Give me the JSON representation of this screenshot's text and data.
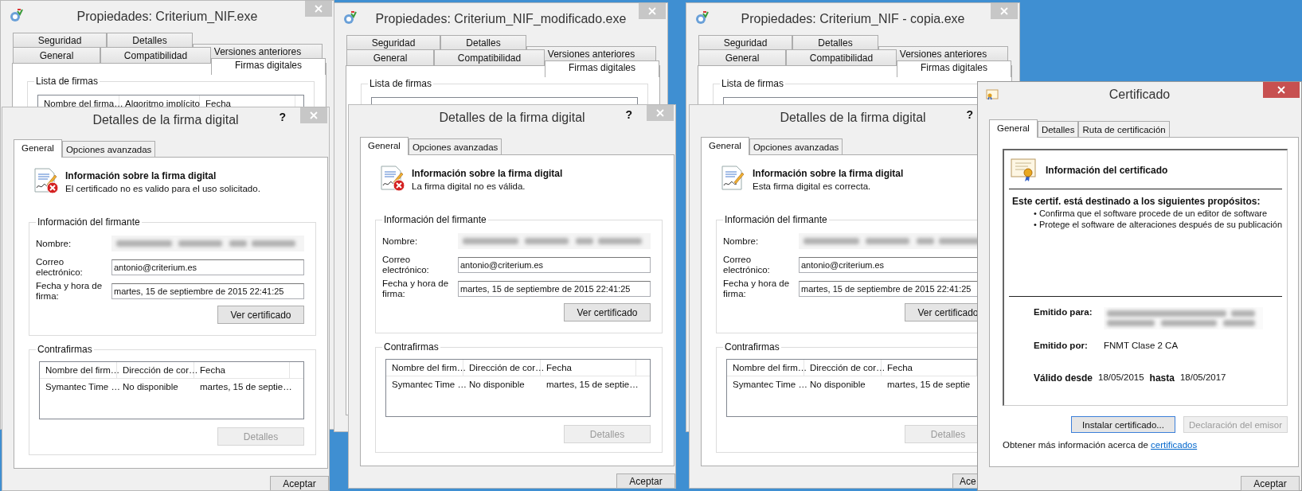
{
  "groups": [
    {
      "properties": {
        "title": "Propiedades: Criterium_NIF.exe",
        "active": false,
        "tab_rows": [
          [
            {
              "label": "Seguridad",
              "selected": false
            },
            {
              "label": "Detalles",
              "selected": false
            },
            {
              "label": "Versiones anteriores",
              "selected": false
            }
          ],
          [
            {
              "label": "General",
              "selected": false
            },
            {
              "label": "Compatibilidad",
              "selected": false
            },
            {
              "label": "Firmas digitales",
              "selected": true
            }
          ]
        ],
        "group_label": "Lista de firmas",
        "columns": [
          "Nombre del firma…",
          "Algoritmo implícito",
          "Fecha"
        ]
      },
      "details": {
        "title": "Detalles de la firma digital",
        "help": "?",
        "tabs": [
          {
            "label": "General",
            "selected": true
          },
          {
            "label": "Opciones avanzadas",
            "selected": false
          }
        ],
        "heading": "Información sobre la firma digital",
        "error_badge": true,
        "message": "El certificado no es valido para el uso solicitado.",
        "signer_group": "Información del firmante",
        "fields": [
          {
            "label": "Nombre:",
            "kind": "redacted"
          },
          {
            "label": "Correo electrónico:",
            "kind": "text",
            "value": "antonio@criterium.es"
          },
          {
            "label": "Fecha y hora de firma:",
            "kind": "text",
            "value": "martes, 15 de septiembre de 2015 22:41:25"
          }
        ],
        "view_button": {
          "label": "Ver certificado",
          "disabled": false
        },
        "countersign_group": "Contrafirmas",
        "countersign_columns": [
          "Nombre del firm…",
          "Dirección de cor…",
          "Fecha"
        ],
        "countersign_rows": [
          [
            "Symantec Time …",
            "No disponible",
            "martes, 15 de septie…"
          ]
        ],
        "details_button": {
          "label": "Detalles",
          "disabled": true
        },
        "ok_button": "Aceptar"
      }
    },
    {
      "properties": {
        "title": "Propiedades: Criterium_NIF_modificado.exe",
        "active": false,
        "tab_rows": [
          [
            {
              "label": "Seguridad",
              "selected": false
            },
            {
              "label": "Detalles",
              "selected": false
            },
            {
              "label": "Versiones anteriores",
              "selected": false
            }
          ],
          [
            {
              "label": "General",
              "selected": false
            },
            {
              "label": "Compatibilidad",
              "selected": false
            },
            {
              "label": "Firmas digitales",
              "selected": true
            }
          ]
        ],
        "group_label": "Lista de firmas"
      },
      "details": {
        "title": "Detalles de la firma digital",
        "help": "?",
        "tabs": [
          {
            "label": "General",
            "selected": true
          },
          {
            "label": "Opciones avanzadas",
            "selected": false
          }
        ],
        "heading": "Información sobre la firma digital",
        "error_badge": true,
        "message": "La firma digital no es válida.",
        "signer_group": "Información del firmante",
        "fields": [
          {
            "label": "Nombre:",
            "kind": "redacted"
          },
          {
            "label": "Correo electrónico:",
            "kind": "text",
            "value": "antonio@criterium.es"
          },
          {
            "label": "Fecha y hora de firma:",
            "kind": "text",
            "value": "martes, 15 de septiembre de 2015 22:41:25"
          }
        ],
        "view_button": {
          "label": "Ver certificado",
          "disabled": false
        },
        "countersign_group": "Contrafirmas",
        "countersign_columns": [
          "Nombre del firm…",
          "Dirección de cor…",
          "Fecha"
        ],
        "countersign_rows": [
          [
            "Symantec Time …",
            "No disponible",
            "martes, 15 de septie…"
          ]
        ],
        "details_button": {
          "label": "Detalles",
          "disabled": true
        },
        "ok_button": "Aceptar"
      }
    },
    {
      "properties": {
        "title": "Propiedades: Criterium_NIF - copia.exe",
        "active": false,
        "tab_rows": [
          [
            {
              "label": "Seguridad",
              "selected": false
            },
            {
              "label": "Detalles",
              "selected": false
            },
            {
              "label": "Versiones anteriores",
              "selected": false
            }
          ],
          [
            {
              "label": "General",
              "selected": false
            },
            {
              "label": "Compatibilidad",
              "selected": false
            },
            {
              "label": "Firmas digitales",
              "selected": true
            }
          ]
        ],
        "group_label": "Lista de firmas"
      },
      "details": {
        "title": "Detalles de la firma digital",
        "help": "?",
        "tabs": [
          {
            "label": "General",
            "selected": true
          },
          {
            "label": "Opciones avanzadas",
            "selected": false
          }
        ],
        "heading": "Información sobre la firma digital",
        "error_badge": false,
        "message": "Esta firma digital es correcta.",
        "signer_group": "Información del firmante",
        "fields": [
          {
            "label": "Nombre:",
            "kind": "redacted"
          },
          {
            "label": "Correo electrónico:",
            "kind": "text",
            "value": "antonio@criterium.es"
          },
          {
            "label": "Fecha y hora de firma:",
            "kind": "text",
            "value": "martes, 15 de septiembre de 2015 22:41:25"
          }
        ],
        "view_button": {
          "label": "Ver certificado",
          "disabled": false
        },
        "countersign_group": "Contrafirmas",
        "countersign_columns": [
          "Nombre del firm…",
          "Dirección de cor…",
          "Fecha"
        ],
        "countersign_rows": [
          [
            "Symantec Time …",
            "No disponible",
            "martes, 15 de septie"
          ]
        ],
        "details_button": {
          "label": "Detalles",
          "disabled": true
        },
        "ok_button": "Ace"
      }
    }
  ],
  "certificate": {
    "title": "Certificado",
    "active": true,
    "tabs": [
      {
        "label": "General",
        "selected": true
      },
      {
        "label": "Detalles",
        "selected": false
      },
      {
        "label": "Ruta de certificación",
        "selected": false
      }
    ],
    "heading": "Información del certificado",
    "purposes_title": "Este certif. está destinado a los siguientes propósitos:",
    "purposes": [
      "• Confirma que el software procede de un editor de software",
      "• Protege el software de alteraciones después de su publicación"
    ],
    "issued_to_label": "Emitido para:",
    "issued_by_label": "Emitido por:",
    "issued_by": "FNMT Clase 2 CA",
    "valid_from_label": "Válido desde",
    "valid_from": "18/05/2015",
    "valid_to_label": "hasta",
    "valid_to": "18/05/2017",
    "install_button": {
      "label": "Instalar certificado...",
      "disabled": false,
      "focused": true
    },
    "statement_button": {
      "label": "Declaración del emisor",
      "disabled": true,
      "focused": false
    },
    "info_text": "Obtener más información acerca de ",
    "info_link": "certificados",
    "ok_button": "Aceptar"
  }
}
